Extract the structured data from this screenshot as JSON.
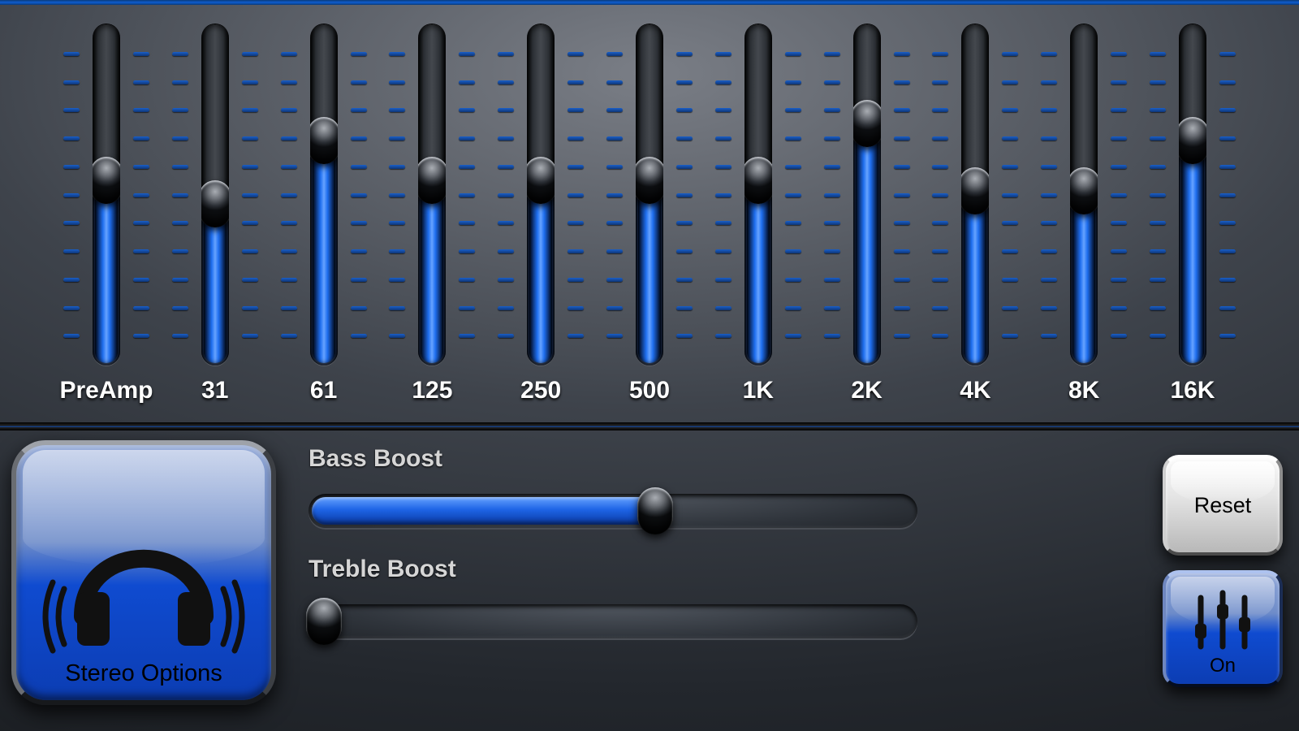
{
  "eq": {
    "bands": [
      {
        "label": "PreAmp",
        "value": 55
      },
      {
        "label": "31",
        "value": 48
      },
      {
        "label": "61",
        "value": 67
      },
      {
        "label": "125",
        "value": 55
      },
      {
        "label": "250",
        "value": 55
      },
      {
        "label": "500",
        "value": 55
      },
      {
        "label": "1K",
        "value": 55
      },
      {
        "label": "2K",
        "value": 72
      },
      {
        "label": "4K",
        "value": 52
      },
      {
        "label": "8K",
        "value": 52
      },
      {
        "label": "16K",
        "value": 67
      }
    ]
  },
  "stereo_label": "Stereo Options",
  "bass": {
    "title": "Bass Boost",
    "value": 57
  },
  "treble": {
    "title": "Treble Boost",
    "value": 2
  },
  "reset_label": "Reset",
  "on_label": "On",
  "colors": {
    "accent": "#1e64e6"
  }
}
